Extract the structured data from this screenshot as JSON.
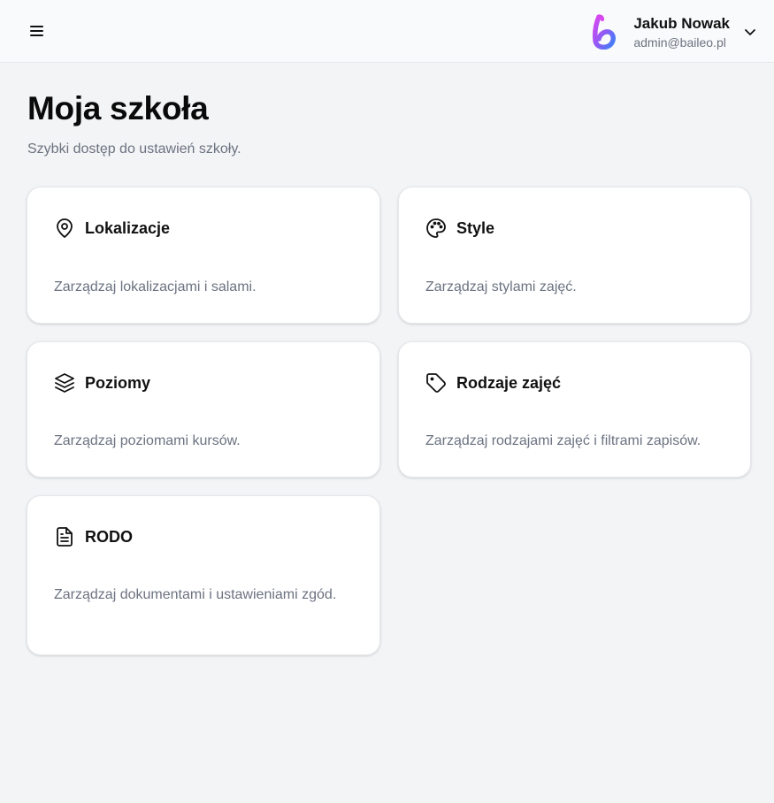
{
  "header": {
    "menu_icon": "hamburger-menu-icon",
    "user": {
      "name": "Jakub Nowak",
      "email": "admin@baileo.pl"
    },
    "logo": "baileo-logo",
    "dropdown_icon": "chevron-down-icon"
  },
  "main": {
    "title": "Moja szkoła",
    "subtitle": "Szybki dostęp do ustawień szkoły."
  },
  "cards": [
    {
      "title": "Lokalizacje",
      "description": "Zarządzaj lokalizacjami i salami.",
      "icon": "map-pin-icon"
    },
    {
      "title": "Style",
      "description": "Zarządzaj stylami zajęć.",
      "icon": "palette-icon"
    },
    {
      "title": "Poziomy",
      "description": "Zarządzaj poziomami kursów.",
      "icon": "layers-icon"
    },
    {
      "title": "Rodzaje zajęć",
      "description": "Zarządzaj rodzajami zajęć i filtrami zapisów.",
      "icon": "tag-icon"
    },
    {
      "title": "RODO",
      "description": "Zarządzaj dokumentami i ustawieniami zgód.",
      "icon": "document-icon"
    }
  ],
  "colors": {
    "background": "#f3f4f6",
    "card": "#ffffff",
    "muted_text": "#6b7280",
    "logo_gradient_start": "#d946ef",
    "logo_gradient_end": "#3b82f6"
  }
}
